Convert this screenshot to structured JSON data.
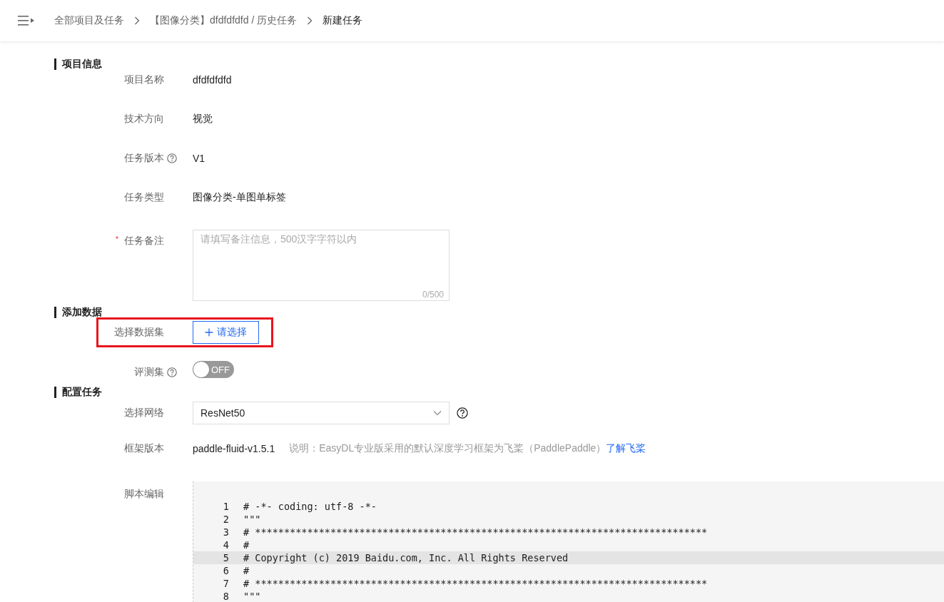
{
  "breadcrumb": [
    {
      "label": "全部项目及任务",
      "current": false
    },
    {
      "label": "【图像分类】dfdfdfdfd / 历史任务",
      "current": false
    },
    {
      "label": "新建任务",
      "current": true
    }
  ],
  "sections": [
    {
      "title": "项目信息",
      "fields": [
        {
          "kind": "text",
          "label": "项目名称",
          "value": "dfdfdfdfd"
        },
        {
          "kind": "text",
          "label": "技术方向",
          "value": "视觉"
        },
        {
          "kind": "text",
          "label": "任务版本",
          "help": true,
          "value": "V1"
        },
        {
          "kind": "text",
          "label": "任务类型",
          "value": "图像分类-单图单标签"
        },
        {
          "kind": "textarea",
          "label": "任务备注",
          "required_mark": "*",
          "placeholder": "请填写备注信息，500汉字字符以内",
          "counter": "0/500"
        }
      ]
    },
    {
      "title": "添加数据",
      "fields": [
        {
          "kind": "add",
          "label": "选择数据集",
          "button": "请选择",
          "highlighted": true
        },
        {
          "kind": "switch",
          "label": "评测集",
          "help": true,
          "on": false,
          "state_text": "OFF"
        }
      ]
    },
    {
      "title": "配置任务",
      "fields": [
        {
          "kind": "select",
          "label": "选择网络",
          "value": "ResNet50",
          "info": true
        },
        {
          "kind": "framework",
          "label": "框架版本",
          "value": "paddle-fluid-v1.5.1",
          "note": "说明：EasyDL专业版采用的默认深度学习框架为飞桨（PaddlePaddle）",
          "link": "了解飞桨"
        },
        {
          "kind": "code",
          "label": "脚本编辑",
          "lines": [
            {
              "number": "1",
              "text": "# -*- coding: utf-8 -*-",
              "highlighted": false
            },
            {
              "number": "2",
              "text": "\"\"\"",
              "highlighted": false
            },
            {
              "number": "3",
              "text": "# ******************************************************************************",
              "highlighted": false
            },
            {
              "number": "4",
              "text": "#",
              "highlighted": false
            },
            {
              "number": "5",
              "text": "# Copyright (c) 2019 Baidu.com, Inc. All Rights Reserved",
              "highlighted": true
            },
            {
              "number": "6",
              "text": "#",
              "highlighted": false
            },
            {
              "number": "7",
              "text": "# ******************************************************************************",
              "highlighted": false
            },
            {
              "number": "8",
              "text": "\"\"\"",
              "highlighted": false
            }
          ]
        }
      ]
    }
  ]
}
